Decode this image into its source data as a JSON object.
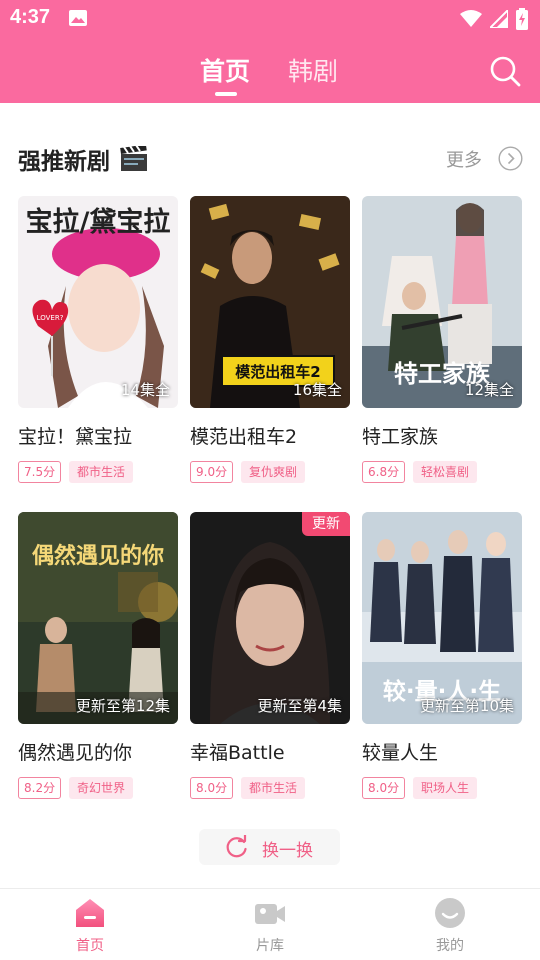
{
  "status_bar": {
    "time": "4:37"
  },
  "header": {
    "tabs": [
      {
        "label": "首页",
        "active": true
      },
      {
        "label": "韩剧",
        "active": false
      }
    ],
    "search_icon": "search-icon"
  },
  "section": {
    "title": "强推新剧",
    "more_label": "更多"
  },
  "cards": [
    {
      "name": "宝拉！黛宝拉",
      "episodes": "14集全",
      "score": "7.5分",
      "genre": "都市生活",
      "poster_text": "宝拉/黛宝拉",
      "badge": ""
    },
    {
      "name": "模范出租车2",
      "episodes": "16集全",
      "score": "9.0分",
      "genre": "复仇爽剧",
      "poster_text": "模范出租车2",
      "badge": ""
    },
    {
      "name": "特工家族",
      "episodes": "12集全",
      "score": "6.8分",
      "genre": "轻松喜剧",
      "poster_text": "特工家族",
      "badge": ""
    },
    {
      "name": "偶然遇见的你",
      "episodes": "更新至第12集",
      "score": "8.2分",
      "genre": "奇幻世界",
      "poster_text": "偶然遇见的你",
      "badge": ""
    },
    {
      "name": "幸福Battle",
      "episodes": "更新至第4集",
      "score": "8.0分",
      "genre": "都市生活",
      "poster_text": "",
      "badge": "更新"
    },
    {
      "name": "较量人生",
      "episodes": "更新至第10集",
      "score": "8.0分",
      "genre": "职场人生",
      "poster_text": "较·量·人·生",
      "badge": ""
    }
  ],
  "refresh": {
    "label": "换一换"
  },
  "bottom_nav": [
    {
      "label": "首页",
      "icon": "home-icon",
      "active": true
    },
    {
      "label": "片库",
      "icon": "video-library-icon",
      "active": false
    },
    {
      "label": "我的",
      "icon": "profile-icon",
      "active": false
    }
  ],
  "colors": {
    "brand_pink": "#fa6a9f",
    "tag_pink": "#f06087",
    "badge_red": "#f24a72"
  }
}
